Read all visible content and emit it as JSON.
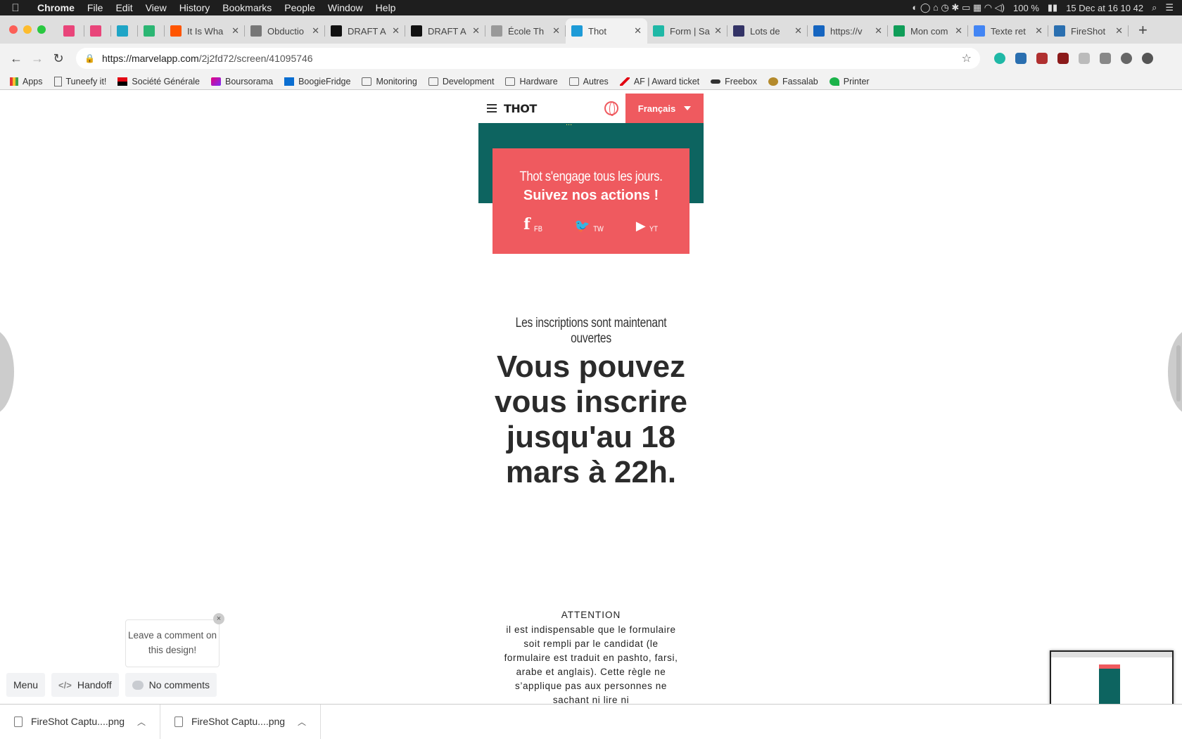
{
  "menubar": {
    "app": "Chrome",
    "items": [
      "File",
      "Edit",
      "View",
      "History",
      "Bookmarks",
      "People",
      "Window",
      "Help"
    ],
    "battery": "100 %",
    "datetime": "15 Dec at  16 10 42"
  },
  "tabs": [
    {
      "label": "",
      "color": "#e9457a",
      "mini": true
    },
    {
      "label": "",
      "color": "#e9457a",
      "mini": true
    },
    {
      "label": "",
      "color": "#1fa5c6",
      "mini": true
    },
    {
      "label": "",
      "color": "#2bb673",
      "mini": true
    },
    {
      "label": "It Is Wha",
      "color": "#ff5500"
    },
    {
      "label": "Obductio",
      "color": "#777777"
    },
    {
      "label": "DRAFT A",
      "color": "#111111"
    },
    {
      "label": "DRAFT A",
      "color": "#111111"
    },
    {
      "label": "École Th",
      "color": "#999999"
    },
    {
      "label": "Thot",
      "color": "#1e9bd7",
      "active": true
    },
    {
      "label": "Form | Sa",
      "color": "#1fb8a6"
    },
    {
      "label": "Lots de",
      "color": "#333366"
    },
    {
      "label": "https://v",
      "color": "#1565c0"
    },
    {
      "label": "Mon com",
      "color": "#0f9d58"
    },
    {
      "label": "Texte ret",
      "color": "#4285f4"
    },
    {
      "label": "FireShot",
      "color": "#2a6fb0"
    }
  ],
  "address": {
    "host": "https://marvelapp.com",
    "path": "/2j2fd72/screen/41095746"
  },
  "bookmarks": [
    {
      "label": "Apps",
      "type": "apps"
    },
    {
      "label": "Tuneefy it!",
      "type": "page"
    },
    {
      "label": "Société Générale",
      "type": "sg"
    },
    {
      "label": "Boursorama",
      "type": "bourso"
    },
    {
      "label": "BoogieFridge",
      "type": "dsm"
    },
    {
      "label": "Monitoring",
      "type": "folder"
    },
    {
      "label": "Development",
      "type": "folder"
    },
    {
      "label": "Hardware",
      "type": "folder"
    },
    {
      "label": "Autres",
      "type": "folder"
    },
    {
      "label": "AF | Award ticket",
      "type": "af"
    },
    {
      "label": "Freebox",
      "type": "freebox"
    },
    {
      "label": "Fassalab",
      "type": "fassa"
    },
    {
      "label": "Printer",
      "type": "printer"
    }
  ],
  "design": {
    "logo": "THOT",
    "language": "Français",
    "cut_text": "...",
    "engage_line1": "Thot s'engage tous les jours.",
    "engage_line2": "Suivez nos actions !",
    "socials": [
      {
        "icon": "f",
        "label": "FB"
      },
      {
        "icon": "🐦",
        "label": "TW"
      },
      {
        "icon": "▶",
        "label": "YT"
      }
    ],
    "kicker": "Les inscriptions sont maintenant ouvertes",
    "headline": "Vous pouvez vous inscrire jusqu'au 18 mars à 22h.",
    "attention": "ATTENTION",
    "body": "il est indispensable que le formulaire soit rempli par le candidat (le formulaire est traduit en pashto, farsi, arabe et anglais). Cette règle ne s’applique pas aux personnes ne sachant ni lire ni"
  },
  "marvel": {
    "comment_prompt": "Leave a comment on this design!",
    "close": "×",
    "menu": "Menu",
    "handoff": "Handoff",
    "comments": "No comments"
  },
  "downloads": [
    {
      "label": "FireShot Captu....png"
    },
    {
      "label": "FireShot Captu....png"
    }
  ]
}
